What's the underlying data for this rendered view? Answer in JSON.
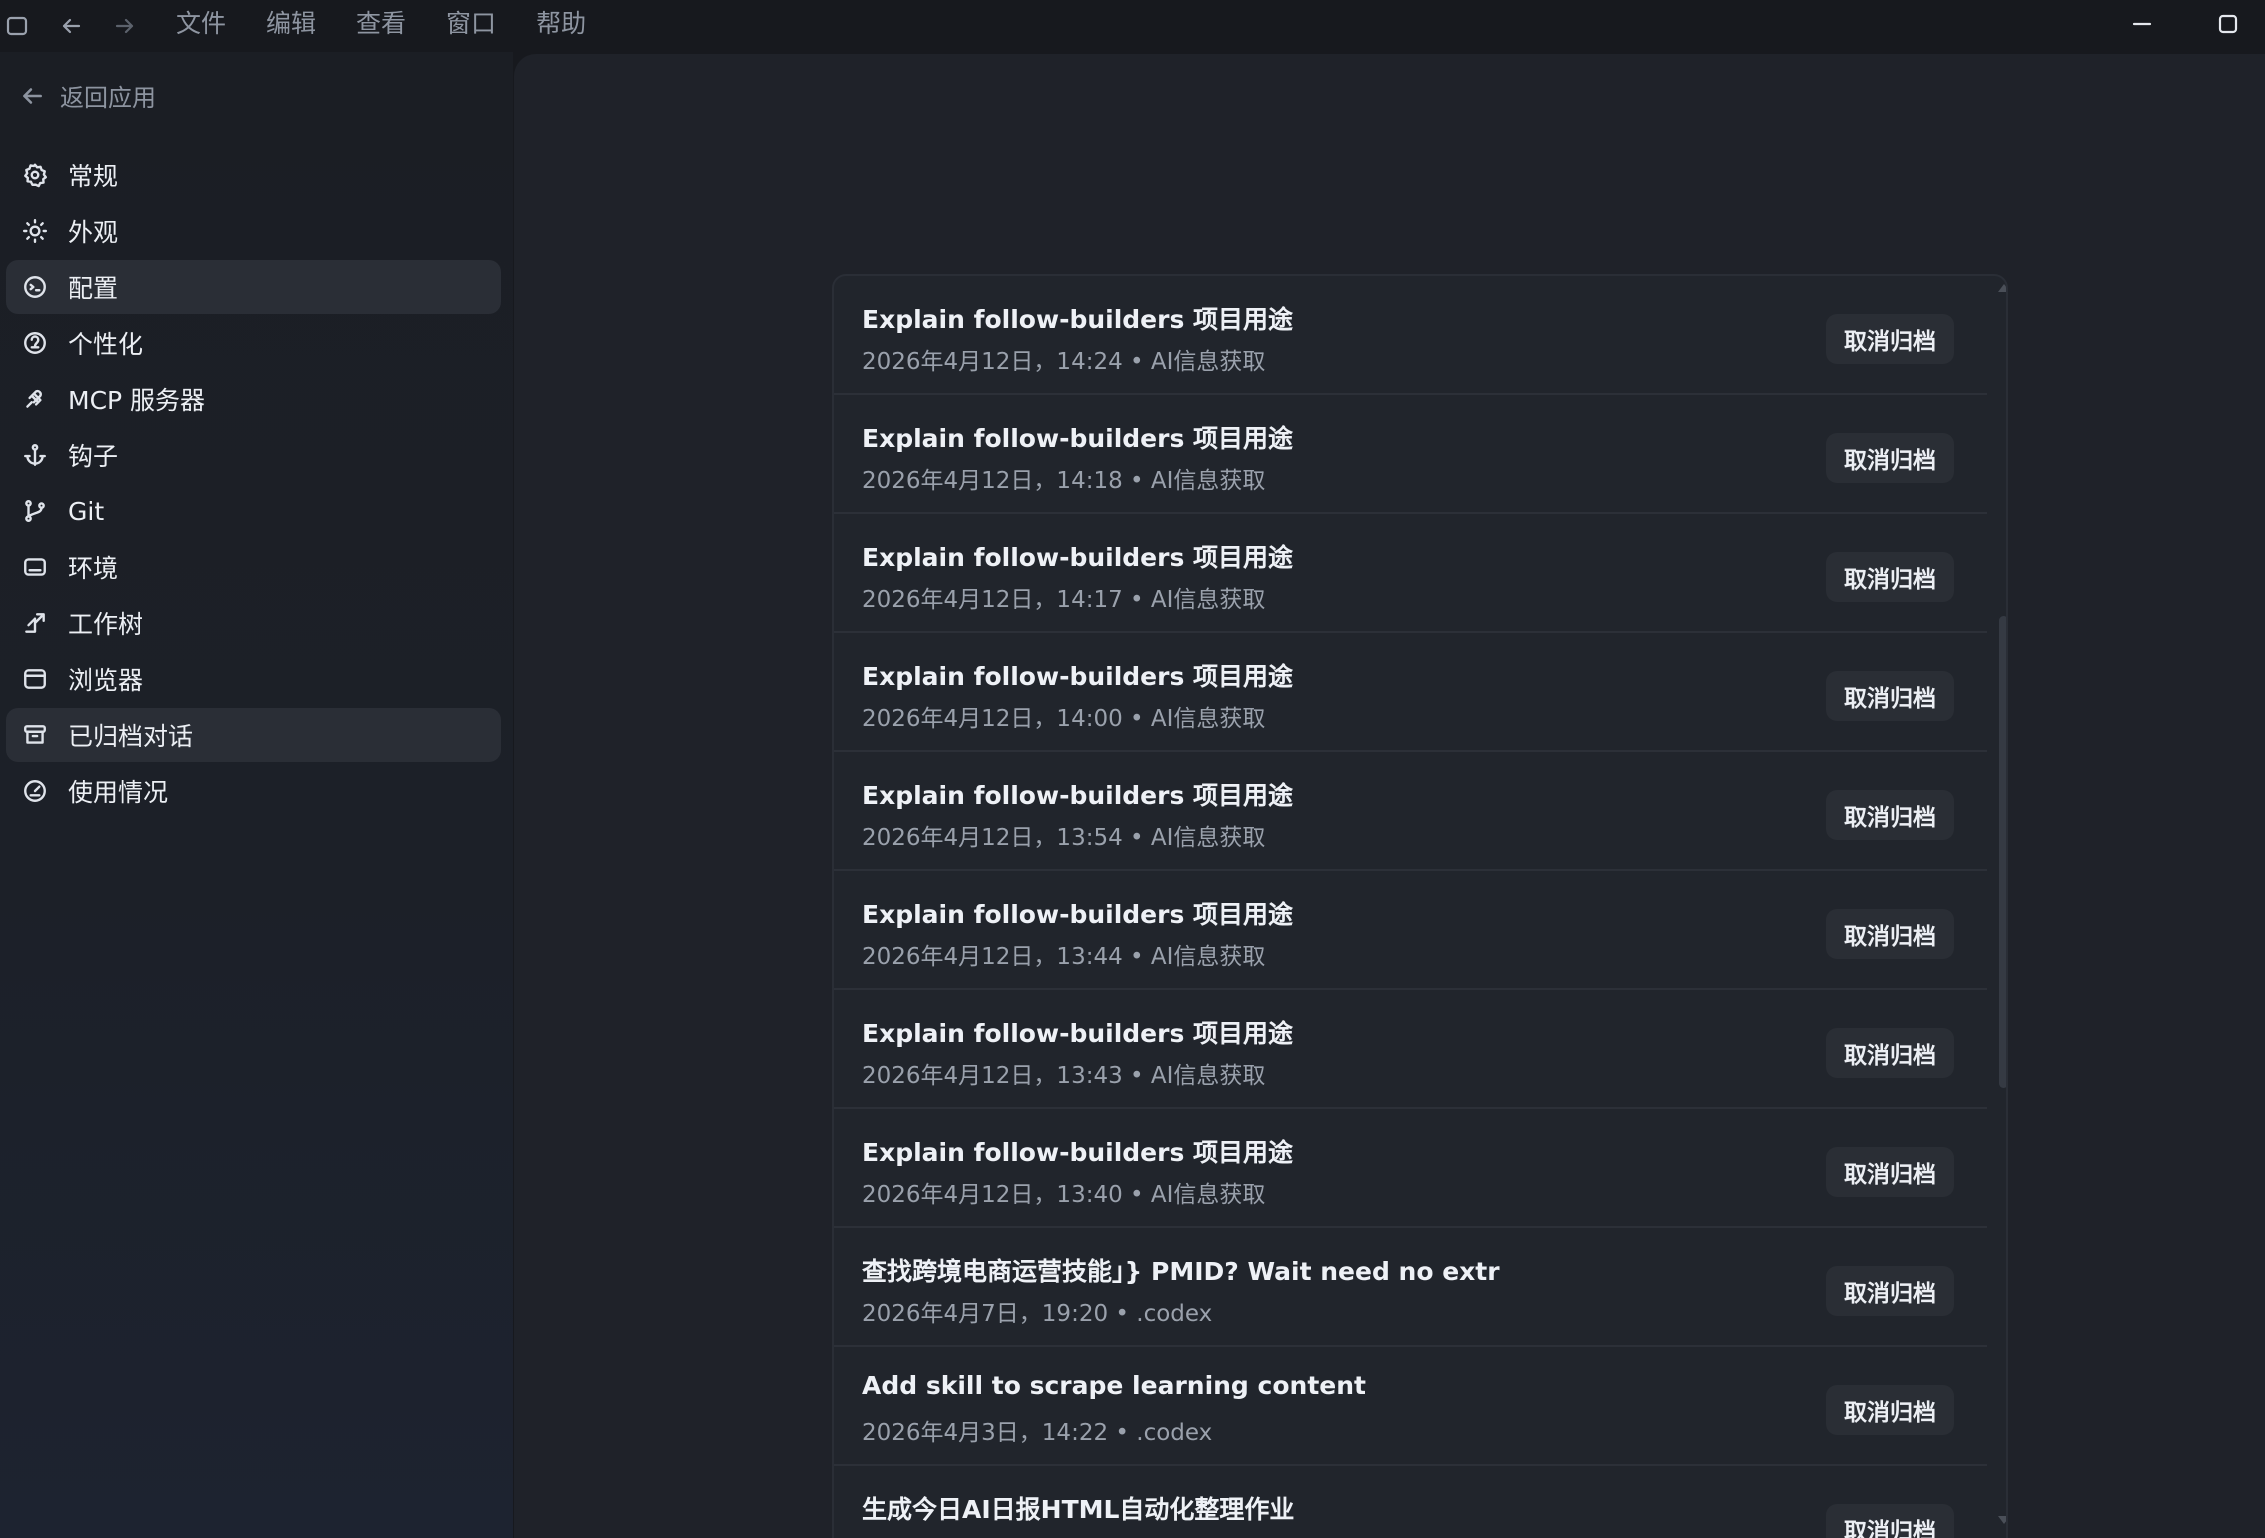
{
  "titlebar": {
    "menu": [
      "文件",
      "编辑",
      "查看",
      "窗口",
      "帮助"
    ]
  },
  "sidebar": {
    "back_label": "返回应用",
    "items": [
      {
        "label": "常规",
        "icon": "gear-icon"
      },
      {
        "label": "外观",
        "icon": "sun-icon"
      },
      {
        "label": "配置",
        "icon": "config-icon",
        "active": true
      },
      {
        "label": "个性化",
        "icon": "personalize-icon"
      },
      {
        "label": "MCP 服务器",
        "icon": "plug-icon"
      },
      {
        "label": "钩子",
        "icon": "anchor-icon"
      },
      {
        "label": "Git",
        "icon": "git-branch-icon"
      },
      {
        "label": "环境",
        "icon": "environment-icon"
      },
      {
        "label": "工作树",
        "icon": "worktree-icon"
      },
      {
        "label": "浏览器",
        "icon": "browser-icon"
      },
      {
        "label": "已归档对话",
        "icon": "archive-icon",
        "active": true
      },
      {
        "label": "使用情况",
        "icon": "gauge-icon"
      }
    ]
  },
  "archived": {
    "button_label": "取消归档",
    "rows": [
      {
        "title": "Explain follow-builders 项目用途",
        "meta": "2026年4月12日，14:24 • AI信息获取"
      },
      {
        "title": "Explain follow-builders 项目用途",
        "meta": "2026年4月12日，14:18 • AI信息获取"
      },
      {
        "title": "Explain follow-builders 项目用途",
        "meta": "2026年4月12日，14:17 • AI信息获取"
      },
      {
        "title": "Explain follow-builders 项目用途",
        "meta": "2026年4月12日，14:00 • AI信息获取"
      },
      {
        "title": "Explain follow-builders 项目用途",
        "meta": "2026年4月12日，13:54 • AI信息获取"
      },
      {
        "title": "Explain follow-builders 项目用途",
        "meta": "2026年4月12日，13:44 • AI信息获取"
      },
      {
        "title": "Explain follow-builders 项目用途",
        "meta": "2026年4月12日，13:43 • AI信息获取"
      },
      {
        "title": "Explain follow-builders 项目用途",
        "meta": "2026年4月12日，13:40 • AI信息获取"
      },
      {
        "title": "查找跨境电商运营技能」} PMID? Wait need no extr",
        "meta": "2026年4月7日，19:20 • .codex"
      },
      {
        "title": "Add skill to scrape learning content",
        "meta": "2026年4月3日，14:22 • .codex"
      },
      {
        "title": "生成今日AI日报HTML自动化整理作业",
        "meta": ""
      }
    ]
  }
}
